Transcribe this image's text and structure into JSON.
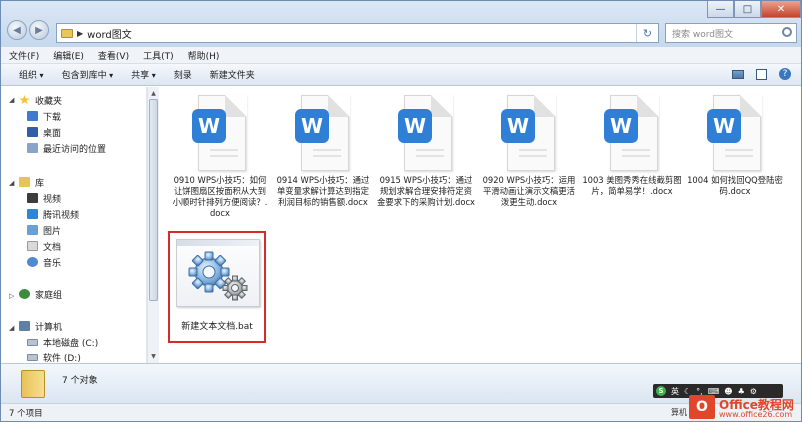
{
  "address": {
    "path": "word图文",
    "search_placeholder": "搜索 word图文"
  },
  "window_controls": {
    "minimize": "—",
    "maximize": "□",
    "close": "✕"
  },
  "menu": [
    "文件(F)",
    "编辑(E)",
    "查看(V)",
    "工具(T)",
    "帮助(H)"
  ],
  "commands": [
    "组织",
    "包含到库中",
    "共享",
    "刻录",
    "新建文件夹"
  ],
  "sidebar": {
    "favorites": {
      "label": "收藏夹",
      "items": [
        "下载",
        "桌面",
        "最近访问的位置"
      ]
    },
    "libraries": {
      "label": "库",
      "items": [
        "视频",
        "腾讯视频",
        "图片",
        "文档",
        "音乐"
      ]
    },
    "homegroup": "家庭组",
    "computer": {
      "label": "计算机",
      "items": [
        "本地磁盘 (C:)",
        "软件 (D:)"
      ]
    }
  },
  "files": [
    {
      "name": "0910 WPS小技巧：如何让饼图扇区按面积从大到小顺时针排列方便阅读？.docx",
      "type": "docx"
    },
    {
      "name": "0914  WPS小技巧：通过单变量求解计算达到指定利润目标的销售额.docx",
      "type": "docx"
    },
    {
      "name": "0915 WPS小技巧：通过规划求解合理安排符定资金要求下的采购计划.docx",
      "type": "docx"
    },
    {
      "name": "0920 WPS小技巧：运用平滑动画让演示文稿更活泼更生动.docx",
      "type": "docx"
    },
    {
      "name": "1003 美图秀秀在线截剪图片，简单易学！.docx",
      "type": "docx"
    },
    {
      "name": "1004 如何找回QQ登陆密码.docx",
      "type": "docx"
    },
    {
      "name": "新建文本文档.bat",
      "type": "bat"
    }
  ],
  "details": {
    "count": "7 个对象"
  },
  "status": {
    "count": "7 个项目"
  },
  "ime": {
    "lang": "英"
  },
  "watermark": {
    "brand": "Office教程网",
    "url": "www.office26.com",
    "pre": "算机"
  },
  "colors": {
    "wps_blue": "#2f7fd6",
    "highlight": "#d72a2a",
    "brand": "#e0472a"
  }
}
